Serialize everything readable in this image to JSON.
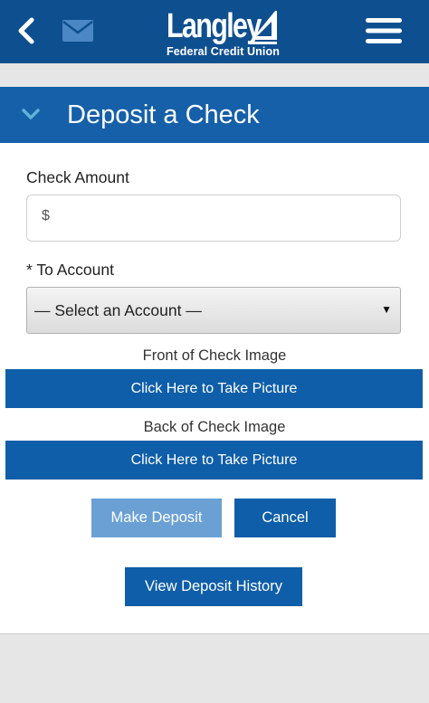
{
  "header": {
    "brand_name": "Langley",
    "brand_sub": "Federal Credit Union",
    "icons": {
      "back": "back-chevron-icon",
      "mail": "mail-icon",
      "menu": "hamburger-menu-icon"
    },
    "colors": {
      "bar": "#0e4f8f",
      "accent_chevron": "#5fb2d6"
    }
  },
  "section": {
    "title": "Deposit a Check",
    "icon": "chevron-down-icon",
    "color": "#1560a9"
  },
  "form": {
    "amount_label": "Check Amount",
    "amount_prefix": "$",
    "amount_value": "",
    "account_label": "* To Account",
    "account_select_value": "— Select an Account —",
    "account_select_arrow": "▼",
    "front_caption": "Front of Check Image",
    "front_button": "Click Here to Take Picture",
    "back_caption": "Back of Check Image",
    "back_button": "Click Here to Take Picture"
  },
  "actions": {
    "deposit_label": "Make Deposit",
    "cancel_label": "Cancel",
    "history_label": "View Deposit History",
    "colors": {
      "primary": "#0f5ea9",
      "disabled": "#6aa0d4"
    }
  }
}
